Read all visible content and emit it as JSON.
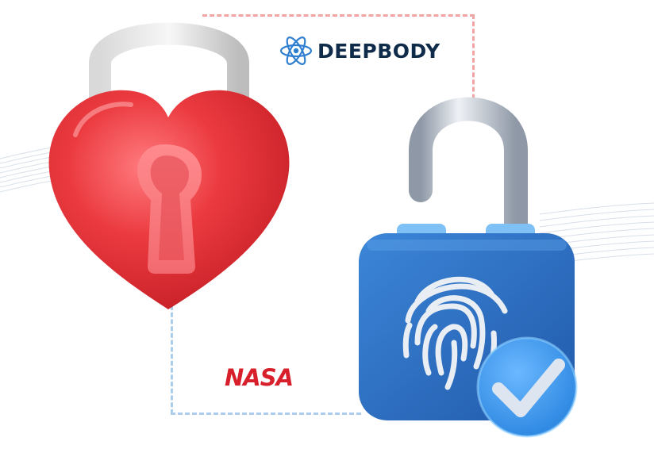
{
  "brands": {
    "deepbody": {
      "name": "DEEPBODY",
      "icon": "atom-icon"
    },
    "nasa": {
      "name": "NASA"
    }
  },
  "illustration": {
    "heart_lock": {
      "icon": "heart-padlock-icon",
      "keyhole": "keyhole-icon"
    },
    "fingerprint_lock": {
      "icon": "fingerprint-padlock-icon",
      "badge": "checkmark-badge-icon"
    }
  },
  "colors": {
    "heart_red": "#e8383d",
    "lock_blue": "#2f6fc4",
    "check_blue": "#4aa3f2",
    "deepbody_navy": "#0f2b4a",
    "nasa_red": "#d7202b",
    "dash_pink": "#f0a4a4",
    "dash_blue": "#a9cdea"
  }
}
